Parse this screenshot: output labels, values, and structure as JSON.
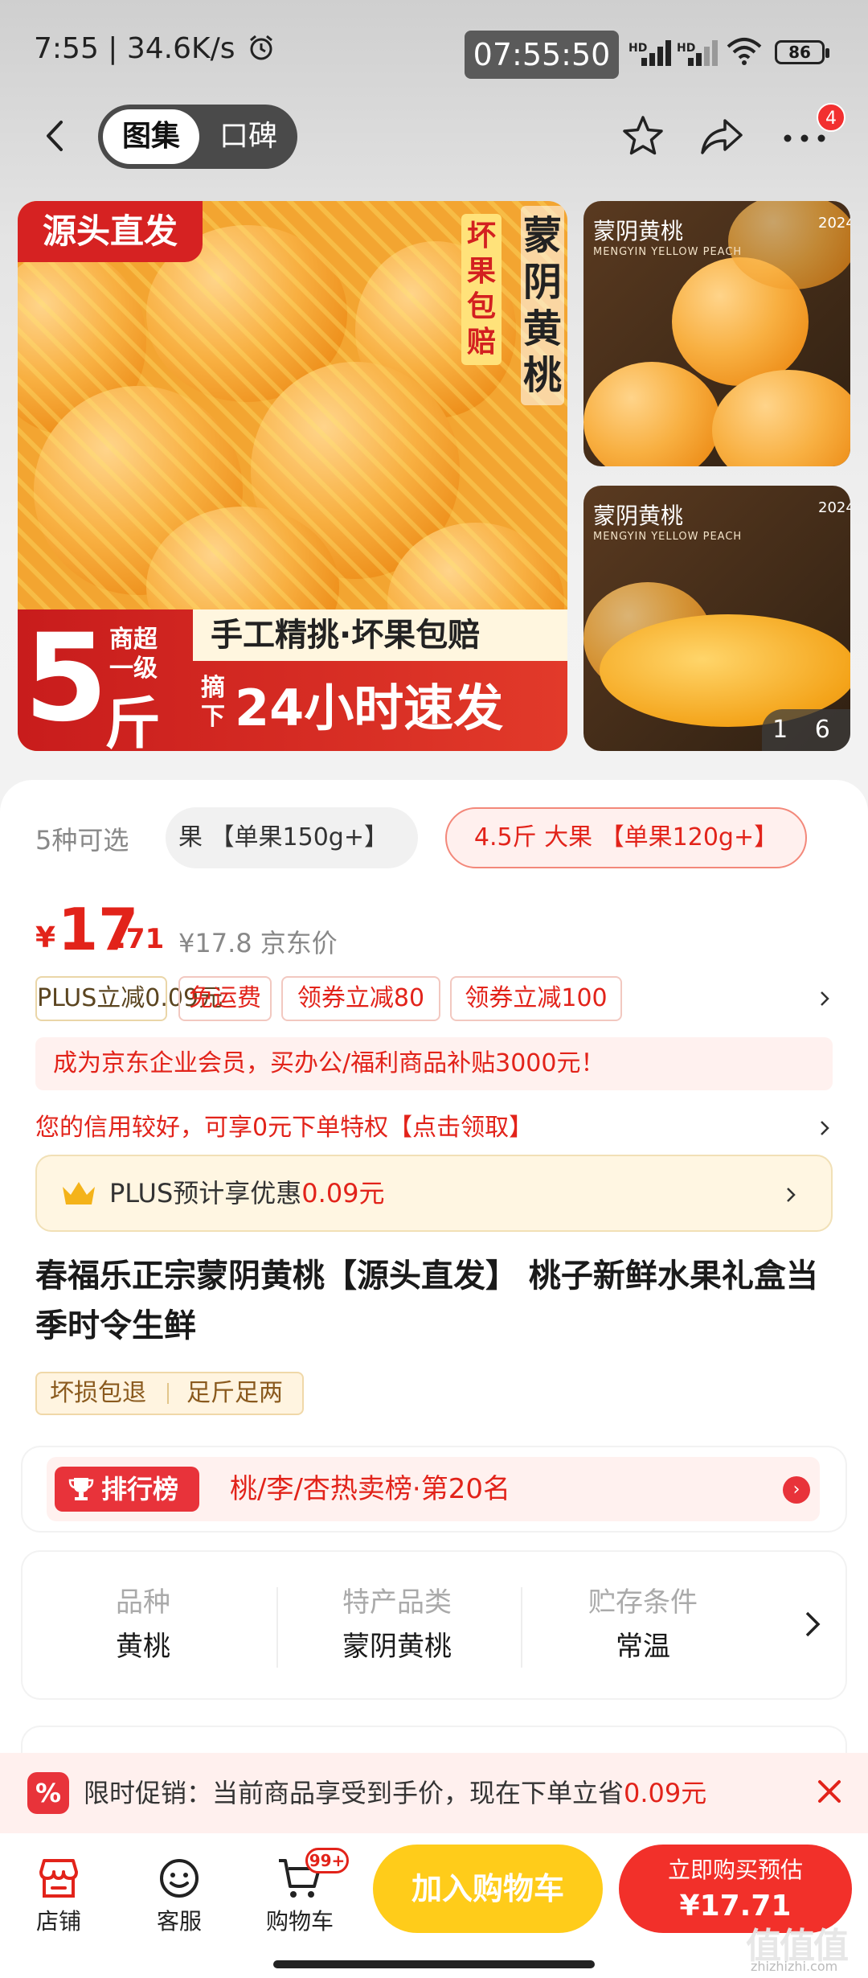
{
  "status_bar": {
    "time": "7:55",
    "speed": "34.6K/s",
    "clock": "07:55:50",
    "sig1": "HD",
    "sig2": "HD",
    "battery": "86"
  },
  "nav": {
    "tab_gallery": "图集",
    "tab_reviews": "口碑",
    "more_badge": "4"
  },
  "gallery": {
    "tag_source": "源头直发",
    "tag_vertical": "蒙阴黄桃",
    "tag_guarantee": "坏果包赔",
    "big_number": "5",
    "tier": "商超一级",
    "unit": "斤",
    "line1": "手工精挑·坏果包赔",
    "pick": "摘下",
    "line2": "24小时速发",
    "side1_title": "蒙阴黄桃",
    "side1_sub": "MENGYIN YELLOW PEACH",
    "side1_year": "2024",
    "side2_title": "蒙阴黄桃",
    "side2_sub": "MENGYIN YELLOW PEACH",
    "side2_year": "2024",
    "page_indicator": "1 6"
  },
  "specs": {
    "count": "5种可选",
    "chip1": "果 【单果150g+】",
    "chip2": "4.5斤 大果 【单果120g+】"
  },
  "price": {
    "currency": "¥",
    "integer": "17",
    "decimal": ".71",
    "jd_price": "¥17.8 京东价"
  },
  "coupons": [
    "PLUS立减0.09元",
    "免运费",
    "领券立减80",
    "领券立减100"
  ],
  "biz_member": "成为京东企业会员，买办公/福利商品补贴3000元！",
  "credit": "您的信用较好，可享0元下单特权【点击领取】",
  "plus_bar": {
    "label": "PLUS预计享优惠",
    "amount": "0.09元"
  },
  "title": "春福乐正宗蒙阴黄桃【源头直发】 桃子新鲜水果礼盒当季时令生鲜",
  "badges": [
    "坏损包退",
    "足斤足两"
  ],
  "ranking": {
    "tag": "排行榜",
    "text": "桃/李/杏热卖榜·第20名"
  },
  "attributes": [
    {
      "k": "品种",
      "v": "黄桃"
    },
    {
      "k": "特产品类",
      "v": "蒙阴黄桃"
    },
    {
      "k": "贮存条件",
      "v": "常温"
    }
  ],
  "promo": {
    "icon": "%",
    "text": "限时促销：当前商品享受到手价，现在下单立省",
    "amount": "0.09元"
  },
  "bottom_bar": {
    "store": "店铺",
    "service": "客服",
    "cart": "购物车",
    "cart_badge": "99+",
    "add_cart": "加入购物车",
    "buy_now": "立即购买预估",
    "buy_price": "¥17.71"
  },
  "watermark": {
    "mark": "值值值",
    "site": "zhizhizhi.com"
  },
  "colors": {
    "accent_red": "#e2231a",
    "cart_yellow": "#ffcc1a",
    "buy_red": "#f2302a"
  }
}
